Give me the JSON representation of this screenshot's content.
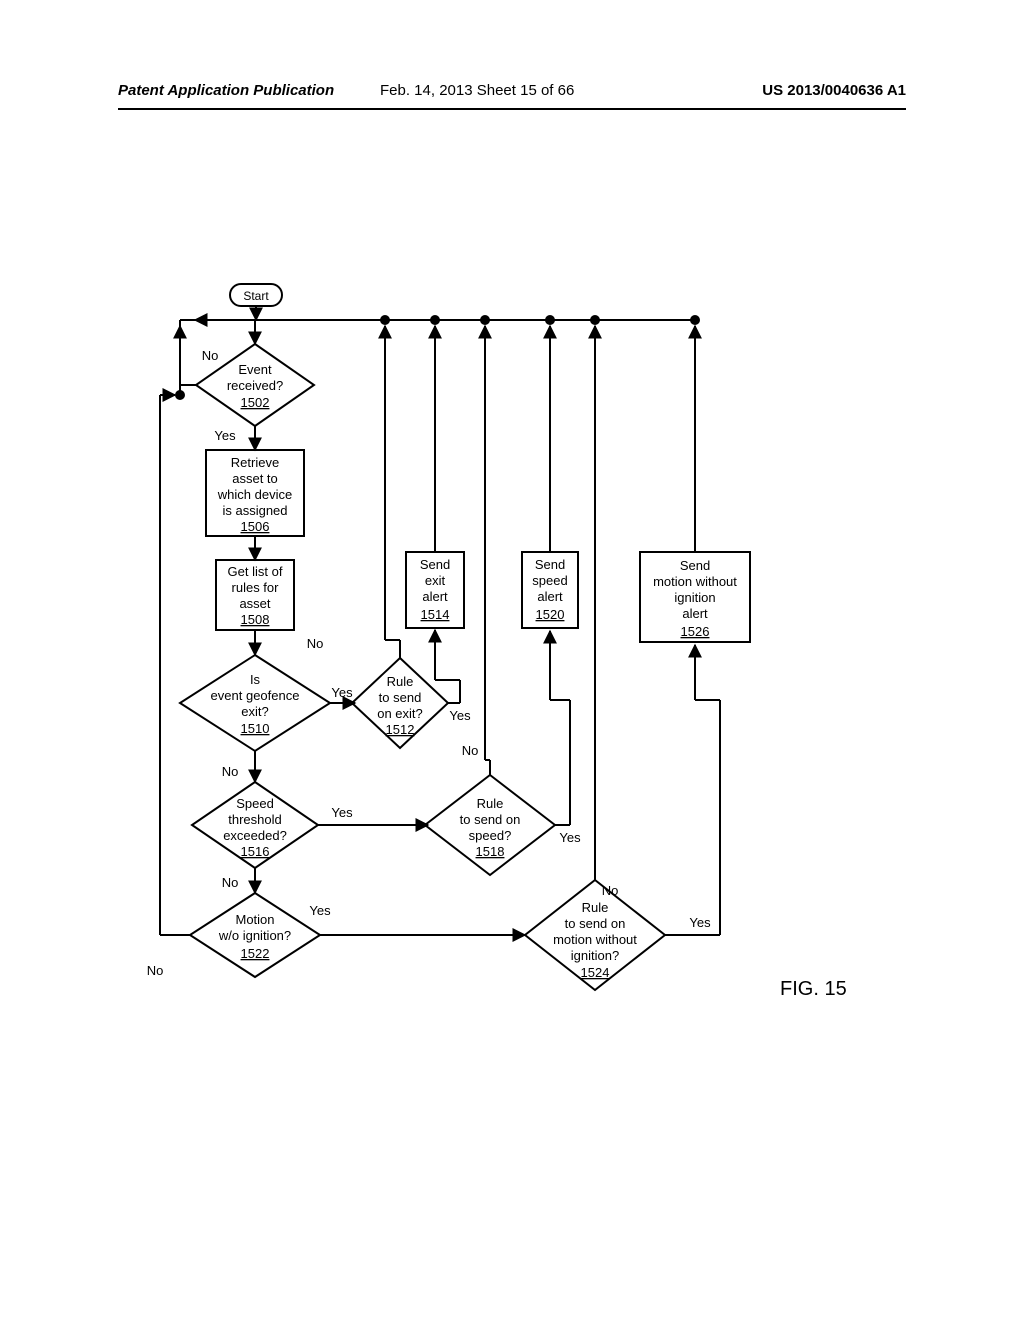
{
  "header": {
    "left": "Patent Application Publication",
    "middle": "Feb. 14, 2013  Sheet 15 of 66",
    "right": "US 2013/0040636 A1"
  },
  "figure_label": "FIG. 15",
  "start": "Start",
  "labels": {
    "yes": "Yes",
    "no": "No"
  },
  "d1502": {
    "l1": "Event",
    "l2": "received?",
    "ref": "1502"
  },
  "p1506": {
    "l1": "Retrieve",
    "l2": "asset to",
    "l3": "which device",
    "l4": "is assigned",
    "ref": "1506"
  },
  "p1508": {
    "l1": "Get list of",
    "l2": "rules for",
    "l3": "asset",
    "ref": "1508"
  },
  "d1510": {
    "l1": "Is",
    "l2": "event geofence",
    "l3": "exit?",
    "ref": "1510"
  },
  "d1512": {
    "l1": "Rule",
    "l2": "to send",
    "l3": "on exit?",
    "ref": "1512"
  },
  "p1514": {
    "l1": "Send",
    "l2": "exit",
    "l3": "alert",
    "ref": "1514"
  },
  "d1516": {
    "l1": "Speed",
    "l2": "threshold",
    "l3": "exceeded?",
    "ref": "1516"
  },
  "d1518": {
    "l1": "Rule",
    "l2": "to send on",
    "l3": "speed?",
    "ref": "1518"
  },
  "p1520": {
    "l1": "Send",
    "l2": "speed",
    "l3": "alert",
    "ref": "1520"
  },
  "d1522": {
    "l1": "Motion",
    "l2": "w/o ignition?",
    "ref": "1522"
  },
  "d1524": {
    "l1": "Rule",
    "l2": "to send on",
    "l3": "motion without",
    "l4": "ignition?",
    "ref": "1524"
  },
  "p1526": {
    "l1": "Send",
    "l2": "motion without",
    "l3": "ignition",
    "l4": "alert",
    "ref": "1526"
  }
}
